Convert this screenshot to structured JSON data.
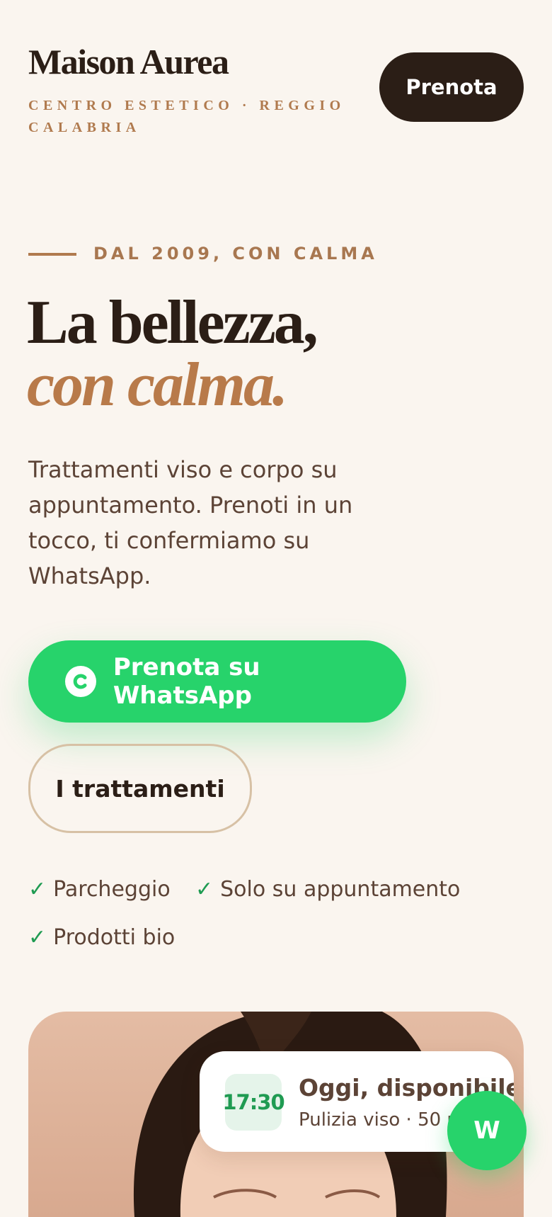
{
  "header": {
    "brand_name": "Maison Aurea",
    "tagline": "CENTRO ESTETICO · REGGIO CALABRIA",
    "cta_label": "Prenota"
  },
  "hero": {
    "eyebrow": "DAL 2009, CON CALMA",
    "title_line1": "La bellezza,",
    "title_line2": "con calma.",
    "lead": "Trattamenti viso e corpo su appuntamento. Prenoti in un tocco, ti confermiamo su WhatsApp.",
    "primary_cta": "Prenota su WhatsApp",
    "secondary_cta": "I trattamenti",
    "features": [
      "Parcheggio",
      "Solo su appuntamento",
      "Prodotti bio"
    ],
    "check_glyph": "✓"
  },
  "availability_card": {
    "time": "17:30",
    "title": "Oggi, disponibile",
    "subtitle": "Pulizia viso · 50 min"
  },
  "fab": {
    "label": "W"
  },
  "icons": {
    "whatsapp": "whatsapp-icon"
  },
  "colors": {
    "background": "#faf5ef",
    "dark": "#2b1e16",
    "accent": "#b87a4a",
    "whatsapp_green": "#27d36b",
    "check_green": "#1f9b52"
  }
}
